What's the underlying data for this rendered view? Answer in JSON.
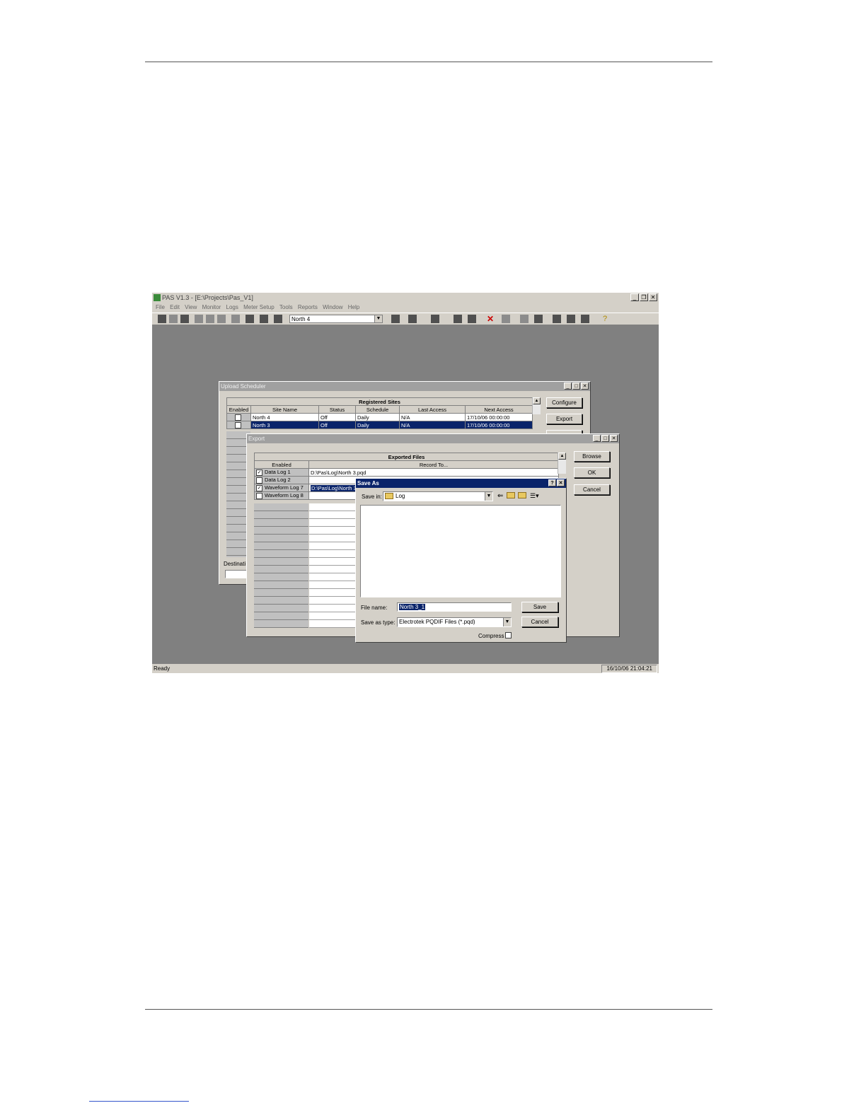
{
  "app": {
    "title": "PAS V1.3 - [E:\\Projects\\Pas_V1]",
    "menu": [
      "File",
      "Edit",
      "View",
      "Monitor",
      "Logs",
      "Meter Setup",
      "Tools",
      "Reports",
      "Window",
      "Help"
    ],
    "site_selector": "North 4",
    "status": "Ready",
    "clock": "16/10/06 21:04:21",
    "icons": [
      "open-folder-icon",
      "save-icon",
      "save-all-icon",
      "cut-icon",
      "copy-icon",
      "paste-icon",
      "print-icon",
      "preview-icon",
      "properties-icon",
      "connect-icon",
      "grid-icon",
      "upload-icon",
      "download-icon",
      "image-icon",
      "chart-icon",
      "delete-icon",
      "window-icon",
      "reset-icon",
      "monitor-icon",
      "data-icon",
      "log-icon",
      "pqu-icon",
      "help-icon"
    ]
  },
  "upload_scheduler": {
    "title": "Upload Scheduler",
    "table_title": "Registered Sites",
    "columns": [
      "Enabled",
      "Site Name",
      "Status",
      "Schedule",
      "Last Access",
      "Next Access"
    ],
    "rows": [
      {
        "site": "North 4",
        "status": "Off",
        "schedule": "Daily",
        "last": "N/A",
        "next": "17/10/06 00:00:00"
      },
      {
        "site": "North 3",
        "status": "Off",
        "schedule": "Daily",
        "last": "N/A",
        "next": "17/10/06 00:00:00"
      }
    ],
    "buttons": {
      "configure": "Configure",
      "export": "Export"
    },
    "destination_label": "Destinati"
  },
  "export": {
    "title": "Export",
    "table_title": "Exported Files",
    "columns": [
      "Enabled",
      "Record To..."
    ],
    "rows": [
      {
        "name": "Data Log 1",
        "checked": true,
        "path": "D:\\Pas\\Log\\North 3.pqd"
      },
      {
        "name": "Data Log 2",
        "checked": false,
        "path": ""
      },
      {
        "name": "Waveform Log 7",
        "checked": true,
        "path": "D:\\Pas\\Log\\North 3"
      },
      {
        "name": "Waveform Log 8",
        "checked": false,
        "path": ""
      }
    ],
    "buttons": {
      "browse": "Browse",
      "ok": "OK",
      "cancel": "Cancel"
    }
  },
  "save_as": {
    "title": "Save As",
    "save_in_label": "Save in:",
    "save_in_value": "Log",
    "file_name_label": "File name:",
    "file_name_value": "North 3_1",
    "save_type_label": "Save as type:",
    "save_type_value": "Electrotek PQDIF Files (*.pqd)",
    "compress_label": "Compress",
    "buttons": {
      "save": "Save",
      "cancel": "Cancel"
    }
  }
}
